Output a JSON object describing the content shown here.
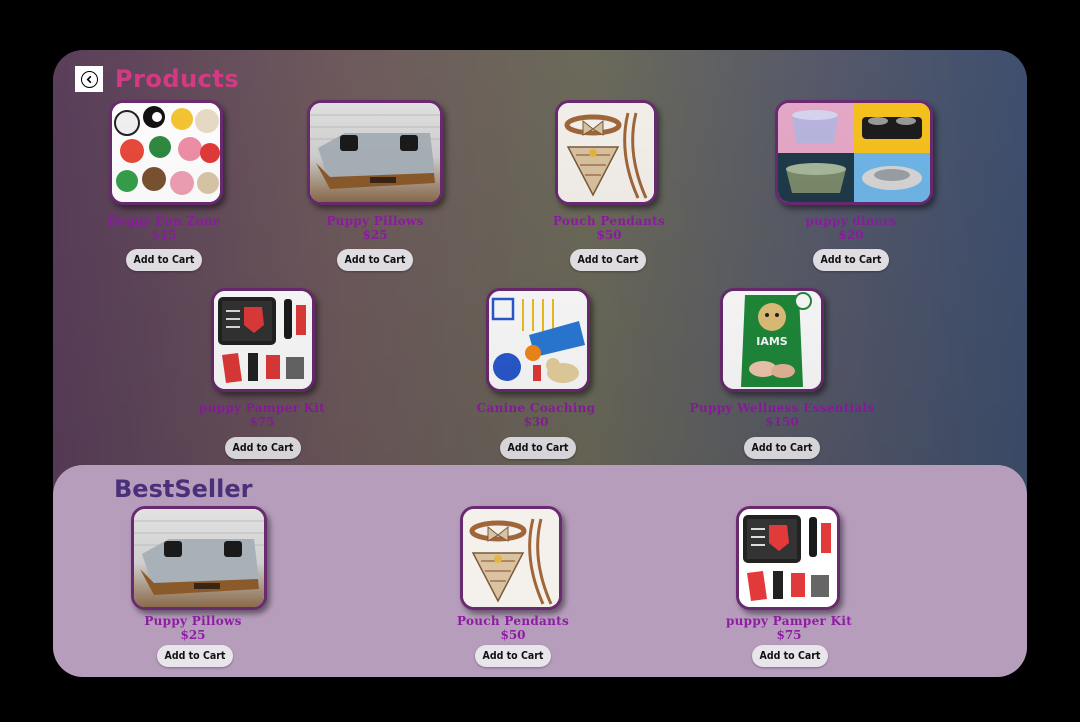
{
  "header": {
    "title": "Products"
  },
  "products": [
    {
      "name": "Doggy Fun Zone",
      "price": "$15",
      "button": "Add to Cart",
      "image": "plush-toys"
    },
    {
      "name": "Puppy Pillows",
      "price": "$25",
      "button": "Add to Cart",
      "image": "dog-bed"
    },
    {
      "name": "Pouch Pendants",
      "price": "$50",
      "button": "Add to Cart",
      "image": "collar-bandana"
    },
    {
      "name": "puppy diners",
      "price": "$20",
      "button": "Add to Cart",
      "image": "food-bowls"
    },
    {
      "name": "puppy Pamper Kit",
      "price": "$75",
      "button": "Add to Cart",
      "image": "grooming-kit"
    },
    {
      "name": "Canine Coaching",
      "price": "$30",
      "button": "Add to Cart",
      "image": "agility-set"
    },
    {
      "name": "Puppy Wellness Essentials",
      "price": "$150",
      "button": "Add to Cart",
      "image": "dog-food-bag"
    }
  ],
  "bestseller": {
    "title": "BestSeller",
    "items": [
      {
        "name": "Puppy Pillows",
        "price": "$25",
        "button": "Add to Cart",
        "image": "dog-bed"
      },
      {
        "name": "Pouch Pendants",
        "price": "$50",
        "button": "Add to Cart",
        "image": "collar-bandana"
      },
      {
        "name": "puppy Pamper Kit",
        "price": "$75",
        "button": "Add to Cart",
        "image": "grooming-kit"
      }
    ]
  },
  "colors": {
    "title": "#d43a84",
    "product_text": "#8e1ca2",
    "bestseller_bg": "#b69dbc",
    "bestseller_title": "#4a2f7a"
  }
}
